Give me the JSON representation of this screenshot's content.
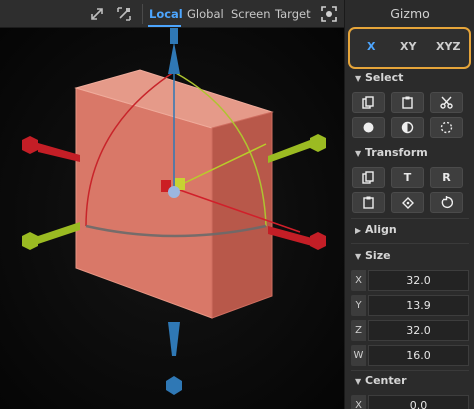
{
  "toolbar": {
    "tabs": [
      {
        "label": "Local",
        "active": true
      },
      {
        "label": "Global",
        "active": false
      },
      {
        "label": "Screen",
        "active": false
      },
      {
        "label": "Target",
        "active": false
      }
    ],
    "icons": [
      "expand-icon",
      "transform-mode-icon",
      "frame-target-icon"
    ]
  },
  "panel": {
    "title": "Gizmo",
    "axes": [
      {
        "label": "X",
        "active": true
      },
      {
        "label": "XY",
        "active": false
      },
      {
        "label": "XYZ",
        "active": false
      }
    ],
    "select": {
      "title": "Select",
      "icons": [
        "copy-icon",
        "paste-icon",
        "cut-icon",
        "circle-filled-icon",
        "half-circle-icon",
        "dotted-circle-icon"
      ]
    },
    "transform": {
      "title": "Transform",
      "buttons": [
        "copy-icon",
        "T",
        "R",
        "paste-icon",
        "rotate-reset-icon",
        "undo-rotate-icon"
      ]
    },
    "align": {
      "title": "Align"
    },
    "size": {
      "title": "Size",
      "fields": [
        {
          "label": "X",
          "value": "32.0"
        },
        {
          "label": "Y",
          "value": "13.9"
        },
        {
          "label": "Z",
          "value": "32.0"
        },
        {
          "label": "W",
          "value": "16.0"
        }
      ]
    },
    "center": {
      "title": "Center",
      "fields": [
        {
          "label": "X",
          "value": "0.0"
        }
      ]
    }
  },
  "colors": {
    "accent": "#4da6ff",
    "highlight_border": "#e6a53a",
    "axis_x": "#d11f2a",
    "axis_y": "#9bbb22",
    "axis_z": "#2f78b5",
    "box": "#e07a6a"
  }
}
